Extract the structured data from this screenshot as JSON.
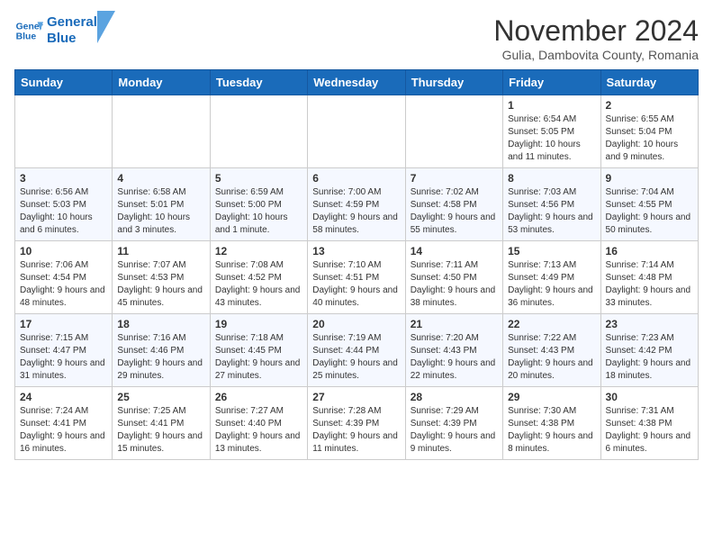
{
  "header": {
    "logo_line1": "General",
    "logo_line2": "Blue",
    "title": "November 2024",
    "subtitle": "Gulia, Dambovita County, Romania"
  },
  "weekdays": [
    "Sunday",
    "Monday",
    "Tuesday",
    "Wednesday",
    "Thursday",
    "Friday",
    "Saturday"
  ],
  "weeks": [
    [
      {
        "day": "",
        "info": ""
      },
      {
        "day": "",
        "info": ""
      },
      {
        "day": "",
        "info": ""
      },
      {
        "day": "",
        "info": ""
      },
      {
        "day": "",
        "info": ""
      },
      {
        "day": "1",
        "info": "Sunrise: 6:54 AM\nSunset: 5:05 PM\nDaylight: 10 hours and 11 minutes."
      },
      {
        "day": "2",
        "info": "Sunrise: 6:55 AM\nSunset: 5:04 PM\nDaylight: 10 hours and 9 minutes."
      }
    ],
    [
      {
        "day": "3",
        "info": "Sunrise: 6:56 AM\nSunset: 5:03 PM\nDaylight: 10 hours and 6 minutes."
      },
      {
        "day": "4",
        "info": "Sunrise: 6:58 AM\nSunset: 5:01 PM\nDaylight: 10 hours and 3 minutes."
      },
      {
        "day": "5",
        "info": "Sunrise: 6:59 AM\nSunset: 5:00 PM\nDaylight: 10 hours and 1 minute."
      },
      {
        "day": "6",
        "info": "Sunrise: 7:00 AM\nSunset: 4:59 PM\nDaylight: 9 hours and 58 minutes."
      },
      {
        "day": "7",
        "info": "Sunrise: 7:02 AM\nSunset: 4:58 PM\nDaylight: 9 hours and 55 minutes."
      },
      {
        "day": "8",
        "info": "Sunrise: 7:03 AM\nSunset: 4:56 PM\nDaylight: 9 hours and 53 minutes."
      },
      {
        "day": "9",
        "info": "Sunrise: 7:04 AM\nSunset: 4:55 PM\nDaylight: 9 hours and 50 minutes."
      }
    ],
    [
      {
        "day": "10",
        "info": "Sunrise: 7:06 AM\nSunset: 4:54 PM\nDaylight: 9 hours and 48 minutes."
      },
      {
        "day": "11",
        "info": "Sunrise: 7:07 AM\nSunset: 4:53 PM\nDaylight: 9 hours and 45 minutes."
      },
      {
        "day": "12",
        "info": "Sunrise: 7:08 AM\nSunset: 4:52 PM\nDaylight: 9 hours and 43 minutes."
      },
      {
        "day": "13",
        "info": "Sunrise: 7:10 AM\nSunset: 4:51 PM\nDaylight: 9 hours and 40 minutes."
      },
      {
        "day": "14",
        "info": "Sunrise: 7:11 AM\nSunset: 4:50 PM\nDaylight: 9 hours and 38 minutes."
      },
      {
        "day": "15",
        "info": "Sunrise: 7:13 AM\nSunset: 4:49 PM\nDaylight: 9 hours and 36 minutes."
      },
      {
        "day": "16",
        "info": "Sunrise: 7:14 AM\nSunset: 4:48 PM\nDaylight: 9 hours and 33 minutes."
      }
    ],
    [
      {
        "day": "17",
        "info": "Sunrise: 7:15 AM\nSunset: 4:47 PM\nDaylight: 9 hours and 31 minutes."
      },
      {
        "day": "18",
        "info": "Sunrise: 7:16 AM\nSunset: 4:46 PM\nDaylight: 9 hours and 29 minutes."
      },
      {
        "day": "19",
        "info": "Sunrise: 7:18 AM\nSunset: 4:45 PM\nDaylight: 9 hours and 27 minutes."
      },
      {
        "day": "20",
        "info": "Sunrise: 7:19 AM\nSunset: 4:44 PM\nDaylight: 9 hours and 25 minutes."
      },
      {
        "day": "21",
        "info": "Sunrise: 7:20 AM\nSunset: 4:43 PM\nDaylight: 9 hours and 22 minutes."
      },
      {
        "day": "22",
        "info": "Sunrise: 7:22 AM\nSunset: 4:43 PM\nDaylight: 9 hours and 20 minutes."
      },
      {
        "day": "23",
        "info": "Sunrise: 7:23 AM\nSunset: 4:42 PM\nDaylight: 9 hours and 18 minutes."
      }
    ],
    [
      {
        "day": "24",
        "info": "Sunrise: 7:24 AM\nSunset: 4:41 PM\nDaylight: 9 hours and 16 minutes."
      },
      {
        "day": "25",
        "info": "Sunrise: 7:25 AM\nSunset: 4:41 PM\nDaylight: 9 hours and 15 minutes."
      },
      {
        "day": "26",
        "info": "Sunrise: 7:27 AM\nSunset: 4:40 PM\nDaylight: 9 hours and 13 minutes."
      },
      {
        "day": "27",
        "info": "Sunrise: 7:28 AM\nSunset: 4:39 PM\nDaylight: 9 hours and 11 minutes."
      },
      {
        "day": "28",
        "info": "Sunrise: 7:29 AM\nSunset: 4:39 PM\nDaylight: 9 hours and 9 minutes."
      },
      {
        "day": "29",
        "info": "Sunrise: 7:30 AM\nSunset: 4:38 PM\nDaylight: 9 hours and 8 minutes."
      },
      {
        "day": "30",
        "info": "Sunrise: 7:31 AM\nSunset: 4:38 PM\nDaylight: 9 hours and 6 minutes."
      }
    ]
  ]
}
